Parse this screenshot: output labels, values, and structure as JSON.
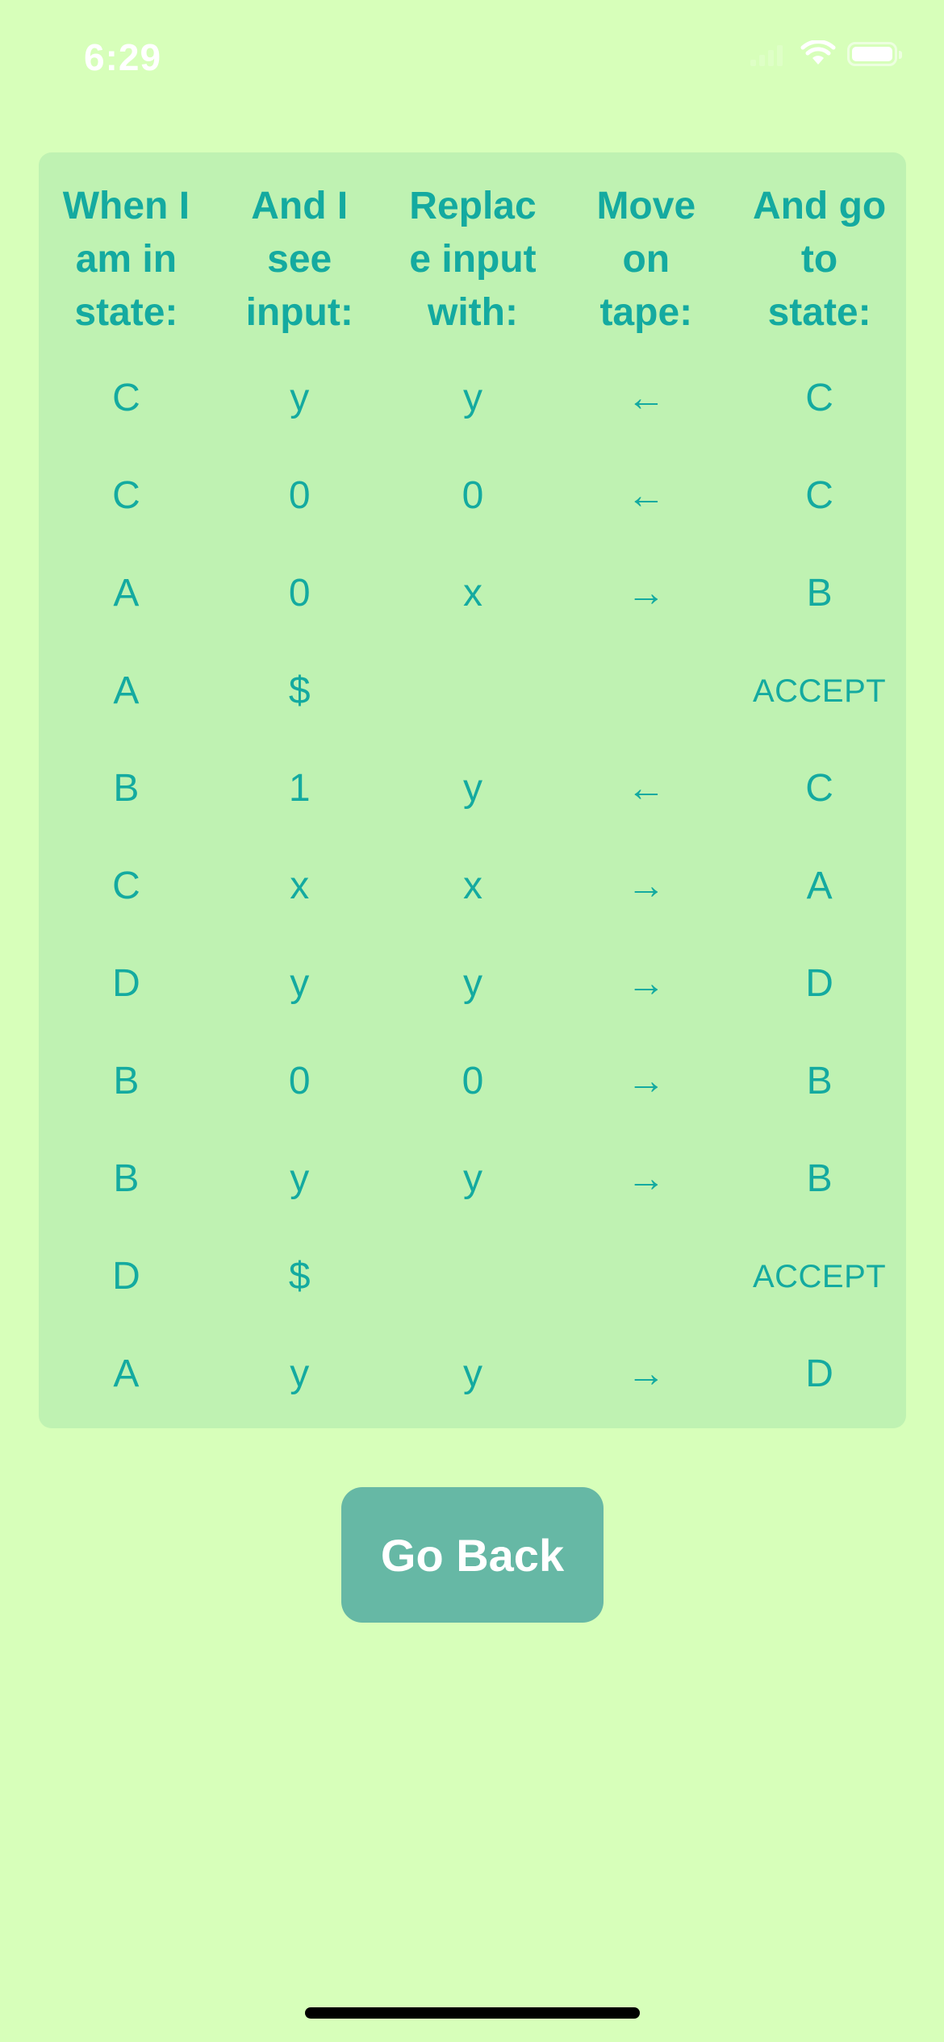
{
  "status_bar": {
    "time": "6:29",
    "icons": [
      "signal-icon",
      "wifi-icon",
      "battery-icon"
    ]
  },
  "table": {
    "headers": [
      "When I am in state:",
      "And I see input:",
      "Replace input with:",
      "Move on tape:",
      "And go to state:"
    ],
    "rows": [
      [
        "C",
        "y",
        "y",
        "←",
        "C"
      ],
      [
        "C",
        "0",
        "0",
        "←",
        "C"
      ],
      [
        "A",
        "0",
        "x",
        "→",
        "B"
      ],
      [
        "A",
        "$",
        "",
        "",
        "ACCEPT"
      ],
      [
        "B",
        "1",
        "y",
        "←",
        "C"
      ],
      [
        "C",
        "x",
        "x",
        "→",
        "A"
      ],
      [
        "D",
        "y",
        "y",
        "→",
        "D"
      ],
      [
        "B",
        "0",
        "0",
        "→",
        "B"
      ],
      [
        "B",
        "y",
        "y",
        "→",
        "B"
      ],
      [
        "D",
        "$",
        "",
        "",
        "ACCEPT"
      ],
      [
        "A",
        "y",
        "y",
        "→",
        "D"
      ]
    ]
  },
  "go_back_label": "Go Back",
  "colors": {
    "background": "#d7ffba",
    "table_background": "#bff2b2",
    "text_accent": "#14aaa0",
    "button": "#66b8a5",
    "button_text": "#ffffff"
  }
}
